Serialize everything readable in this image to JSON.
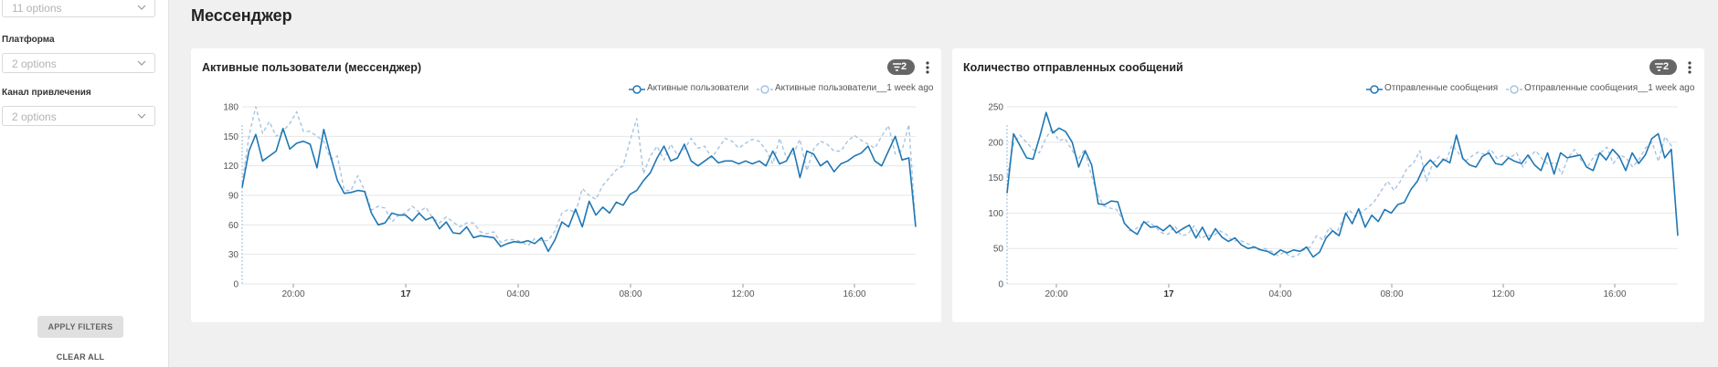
{
  "sidebar": {
    "top_select": {
      "value": "11 options"
    },
    "filters": [
      {
        "label": "Платформа",
        "value": "2 options"
      },
      {
        "label": "Канал привлечения",
        "value": "2 options"
      }
    ],
    "apply_label": "APPLY FILTERS",
    "clear_label": "CLEAR ALL"
  },
  "section": {
    "title": "Мессенджер"
  },
  "colors": {
    "current": "#1f77b4",
    "previous": "#a6c4e2",
    "grid": "#e6e6e6",
    "badge": "#666666"
  },
  "cards": [
    {
      "title": "Активные пользователи (мессенджер)",
      "filter_count": "2",
      "legend": [
        "Активные пользователи",
        "Активные пользователи__1 week ago"
      ]
    },
    {
      "title": "Количество отправленных сообщений",
      "filter_count": "2",
      "legend": [
        "Отправленные сообщения",
        "Отправленные сообщения__1 week ago"
      ]
    }
  ],
  "chart_data": [
    {
      "type": "line",
      "title": "Активные пользователи (мессенджер)",
      "x_ticks": [
        "20:00",
        "17",
        "04:00",
        "08:00",
        "12:00",
        "16:00"
      ],
      "x_ticks_bold": [
        "17"
      ],
      "y_ticks": [
        0,
        30,
        60,
        90,
        120,
        150,
        180
      ],
      "ylim": [
        0,
        180
      ],
      "grid": true,
      "legend_position": "top-right",
      "series": [
        {
          "name": "Активные пользователи",
          "values": [
            98,
            135,
            152,
            125,
            130,
            135,
            158,
            137,
            143,
            145,
            142,
            118,
            157,
            130,
            105,
            92,
            93,
            95,
            94,
            72,
            60,
            62,
            72,
            70,
            70,
            64,
            72,
            65,
            68,
            56,
            63,
            52,
            51,
            58,
            47,
            49,
            48,
            47,
            38,
            41,
            43,
            42,
            44,
            41,
            47,
            33,
            45,
            63,
            58,
            76,
            58,
            84,
            70,
            78,
            72,
            83,
            80,
            91,
            95,
            105,
            113,
            128,
            140,
            125,
            128,
            142,
            125,
            120,
            125,
            130,
            123,
            125,
            125,
            122,
            125,
            122,
            125,
            120,
            135,
            122,
            125,
            138,
            108,
            135,
            132,
            120,
            125,
            114,
            122,
            125,
            130,
            133,
            140,
            125,
            120,
            135,
            150,
            126,
            128,
            58
          ]
        },
        {
          "name": "Активные пользователи__1 week ago",
          "values": [
            102,
            150,
            180,
            153,
            165,
            150,
            155,
            163,
            175,
            155,
            155,
            150,
            145,
            127,
            130,
            95,
            95,
            110,
            95,
            75,
            79,
            77,
            63,
            70,
            72,
            79,
            73,
            78,
            67,
            62,
            68,
            63,
            58,
            62,
            62,
            53,
            51,
            53,
            42,
            45,
            45,
            43,
            39,
            46,
            44,
            44,
            54,
            72,
            76,
            72,
            97,
            90,
            86,
            100,
            108,
            116,
            120,
            145,
            168,
            112,
            130,
            140,
            126,
            142,
            131,
            137,
            148,
            138,
            140,
            128,
            138,
            148,
            145,
            138,
            143,
            147,
            145,
            136,
            122,
            148,
            128,
            132,
            147,
            115,
            137,
            145,
            142,
            135,
            135,
            145,
            151,
            146,
            142,
            138,
            150,
            161,
            132,
            136,
            162,
            58
          ]
        }
      ]
    },
    {
      "type": "line",
      "title": "Количество отправленных сообщений",
      "x_ticks": [
        "20:00",
        "17",
        "04:00",
        "08:00",
        "12:00",
        "16:00"
      ],
      "x_ticks_bold": [
        "17"
      ],
      "y_ticks": [
        0,
        50,
        100,
        150,
        200,
        250
      ],
      "ylim": [
        0,
        250
      ],
      "grid": true,
      "legend_position": "top-right",
      "series": [
        {
          "name": "Отправленные сообщения",
          "values": [
            128,
            212,
            195,
            178,
            176,
            207,
            242,
            213,
            220,
            215,
            200,
            165,
            188,
            168,
            113,
            112,
            117,
            116,
            86,
            76,
            70,
            88,
            80,
            81,
            75,
            83,
            72,
            78,
            83,
            65,
            80,
            62,
            78,
            66,
            60,
            65,
            55,
            50,
            52,
            48,
            46,
            41,
            48,
            44,
            48,
            46,
            52,
            38,
            45,
            65,
            75,
            68,
            100,
            85,
            106,
            80,
            97,
            88,
            105,
            100,
            112,
            115,
            133,
            145,
            165,
            175,
            165,
            176,
            171,
            210,
            177,
            168,
            165,
            180,
            185,
            170,
            168,
            178,
            173,
            170,
            182,
            168,
            160,
            185,
            155,
            185,
            178,
            180,
            182,
            165,
            160,
            185,
            175,
            190,
            180,
            160,
            185,
            170,
            182,
            205,
            212,
            178,
            190,
            68
          ]
        },
        {
          "name": "Отправленные сообщения__1 week ago",
          "values": [
            150,
            198,
            210,
            200,
            190,
            185,
            205,
            220,
            202,
            205,
            190,
            175,
            190,
            155,
            128,
            110,
            107,
            105,
            90,
            75,
            78,
            85,
            88,
            80,
            72,
            70,
            82,
            68,
            70,
            82,
            64,
            69,
            68,
            75,
            70,
            60,
            62,
            58,
            54,
            48,
            50,
            46,
            40,
            45,
            38,
            40,
            48,
            52,
            68,
            62,
            80,
            70,
            90,
            105,
            95,
            102,
            108,
            117,
            131,
            145,
            132,
            145,
            163,
            170,
            188,
            145,
            170,
            180,
            172,
            196,
            185,
            173,
            180,
            186,
            183,
            190,
            177,
            182,
            178,
            185,
            165,
            180,
            188,
            176,
            168,
            172,
            155,
            178,
            190,
            175,
            165,
            180,
            185,
            193,
            170,
            182,
            178,
            165,
            176,
            192,
            200,
            173,
            208,
            195,
            68
          ]
        }
      ]
    }
  ]
}
